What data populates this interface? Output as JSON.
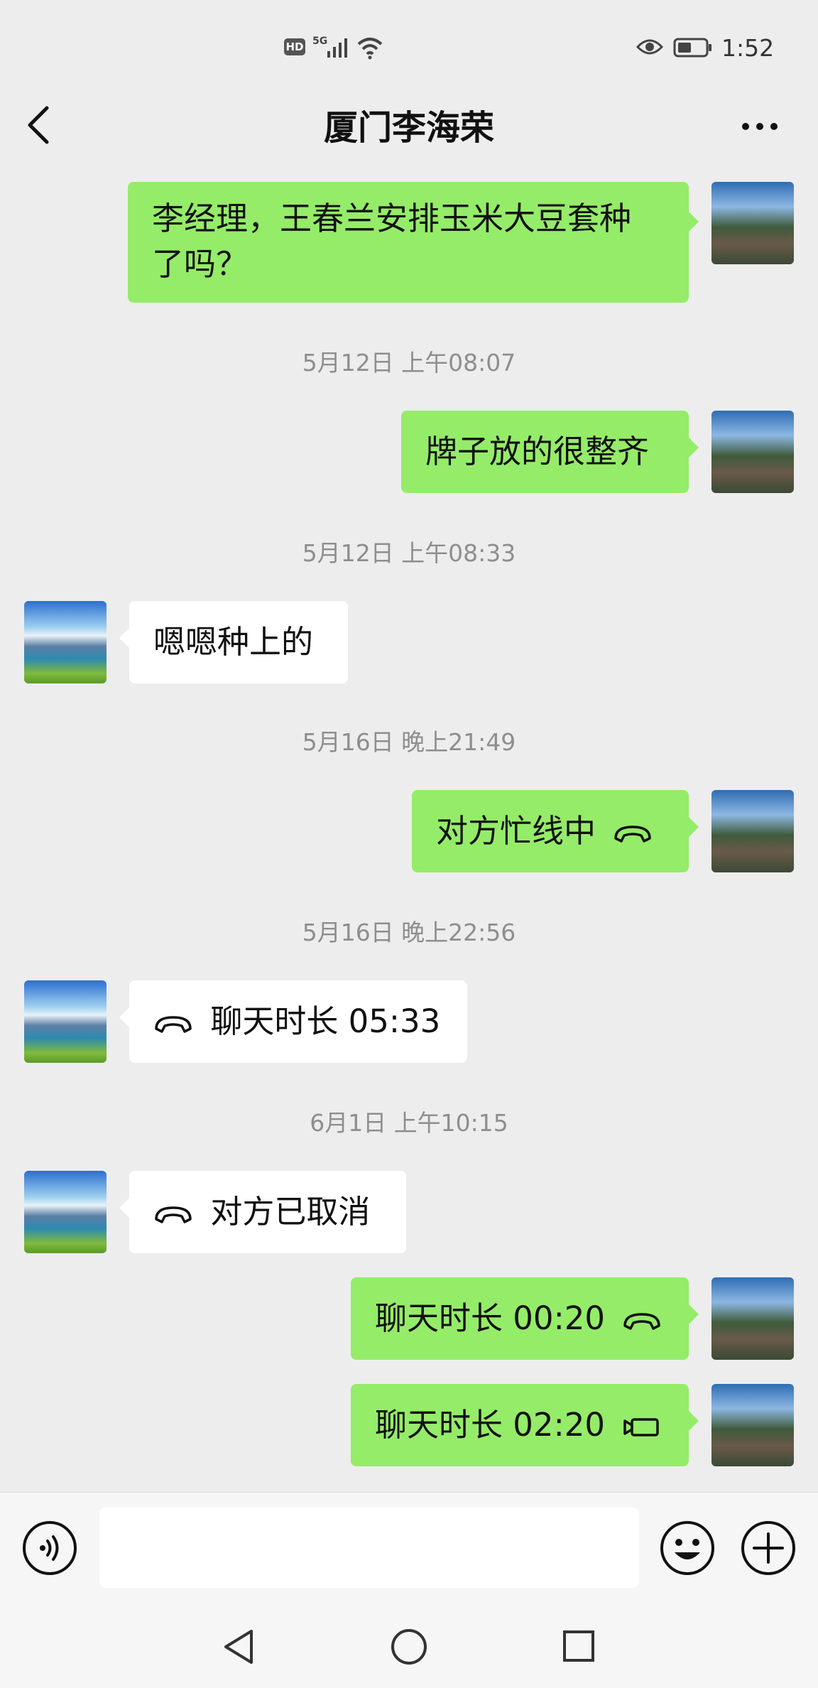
{
  "status_bar": {
    "hd_badge": "HD",
    "network": "5G",
    "time": "1:52",
    "icons": [
      "signal-icon",
      "wifi-icon",
      "eye-icon",
      "battery-icon"
    ]
  },
  "header": {
    "title": "厦门李海荣",
    "back_icon": "chevron-left-icon",
    "more_icon": "more-dots-icon"
  },
  "messages": [
    {
      "type": "bubble",
      "from": "self",
      "lines": [
        "李经理，王春兰安排玉米大豆套种",
        "了吗？"
      ]
    },
    {
      "type": "time",
      "text": "5月12日 上午08:07"
    },
    {
      "type": "bubble",
      "from": "self",
      "text": "牌子放的很整齐"
    },
    {
      "type": "time",
      "text": "5月12日 上午08:33"
    },
    {
      "type": "bubble",
      "from": "other",
      "text": "嗯嗯种上的"
    },
    {
      "type": "time",
      "text": "5月16日 晚上21:49"
    },
    {
      "type": "call",
      "from": "self",
      "text": "对方忙线中",
      "icon": "phone-icon"
    },
    {
      "type": "time",
      "text": "5月16日 晚上22:56"
    },
    {
      "type": "call",
      "from": "other",
      "text": "聊天时长 05:33",
      "icon": "phone-icon"
    },
    {
      "type": "time",
      "text": "6月1日 上午10:15"
    },
    {
      "type": "call",
      "from": "other",
      "text": "对方已取消",
      "icon": "phone-icon"
    },
    {
      "type": "call",
      "from": "self",
      "text": "聊天时长 00:20",
      "icon": "phone-icon"
    },
    {
      "type": "call",
      "from": "self",
      "text": "聊天时长 02:20",
      "icon": "video-icon"
    }
  ],
  "input_bar": {
    "voice_icon": "voice-icon",
    "text_value": "",
    "emoji_icon": "emoji-icon",
    "plus_icon": "plus-icon"
  },
  "nav_bar": {
    "icons": [
      "nav-back-icon",
      "nav-home-icon",
      "nav-recent-icon"
    ]
  },
  "colors": {
    "background": "#ededed",
    "self_bubble": "#95ec69",
    "other_bubble": "#ffffff",
    "timestamp": "#8e8e8e"
  }
}
